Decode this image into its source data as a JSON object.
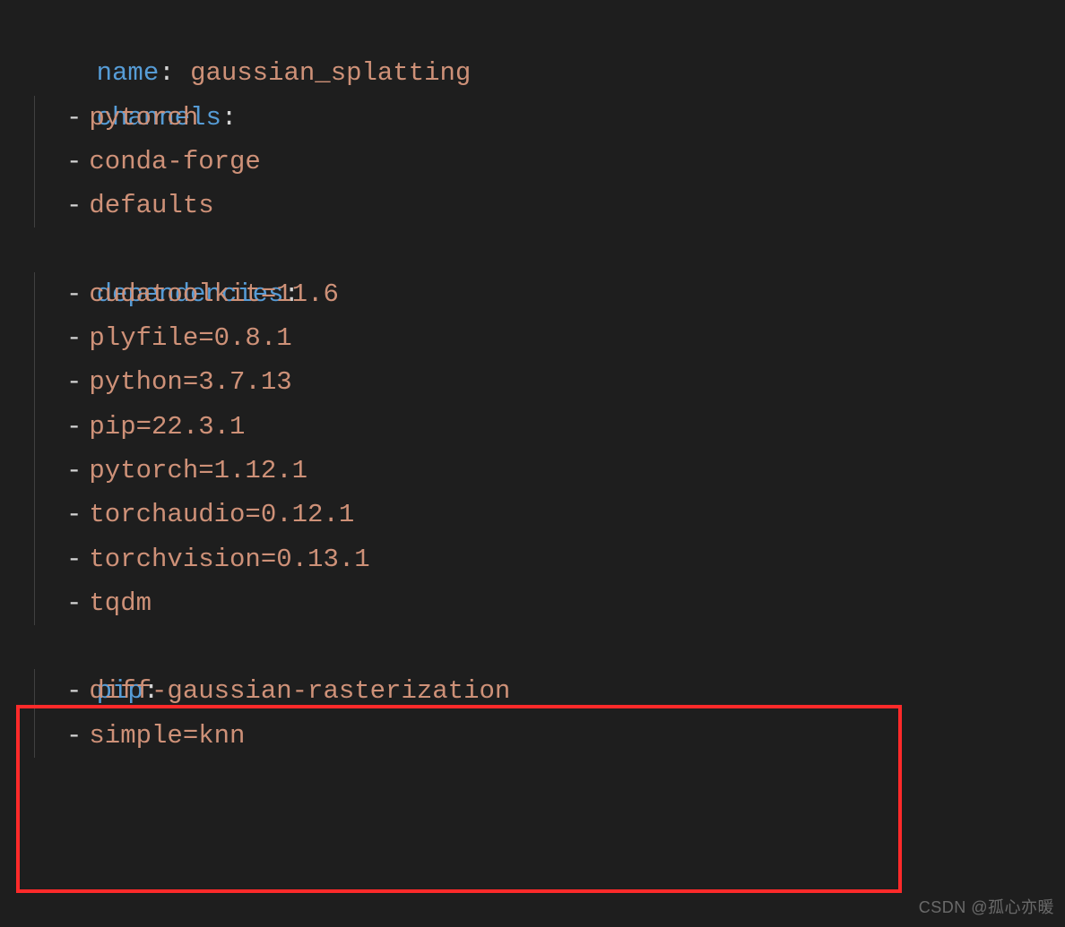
{
  "yaml": {
    "nameKey": "name",
    "nameValue": "gaussian_splatting",
    "channelsKey": "channels",
    "channels": [
      "pytorch",
      "conda-forge",
      "defaults"
    ],
    "dependenciesKey": "dependencies",
    "dependencies": [
      "cudatoolkit=11.6",
      "plyfile=0.8.1",
      "python=3.7.13",
      "pip=22.3.1",
      "pytorch=1.12.1",
      "torchaudio=0.12.1",
      "torchvision=0.13.1",
      "tqdm"
    ],
    "pipKey": "pip",
    "pip": [
      "diff-gaussian-rasterization",
      "simple=knn"
    ]
  },
  "watermark": "CSDN @孤心亦暖"
}
